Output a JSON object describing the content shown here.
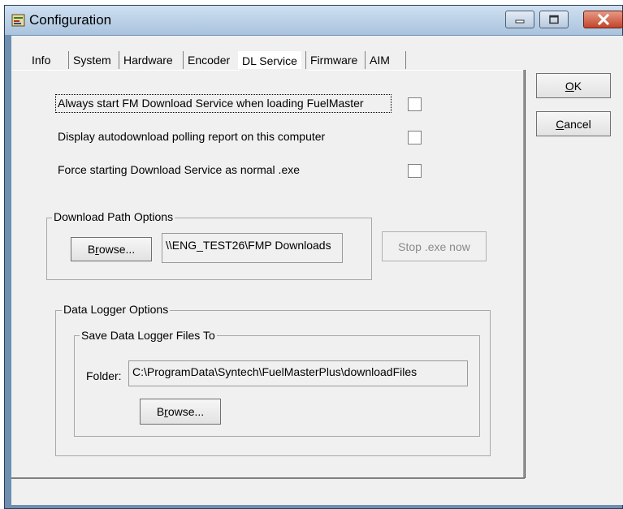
{
  "window": {
    "title": "Configuration",
    "icon": "configuration-app-icon",
    "controls": [
      "minimize-icon",
      "maximize-icon",
      "close-icon"
    ]
  },
  "tabs": [
    {
      "label": "Info",
      "active": false
    },
    {
      "label": "System",
      "active": false
    },
    {
      "label": "Hardware",
      "active": false
    },
    {
      "label": "Encoder",
      "active": false
    },
    {
      "label": "DL Service",
      "active": true
    },
    {
      "label": "Firmware",
      "active": false
    },
    {
      "label": "AIM",
      "active": false
    }
  ],
  "buttons": {
    "ok": {
      "pre": "",
      "mnemonic": "O",
      "post": "K"
    },
    "cancel": {
      "pre": "",
      "mnemonic": "C",
      "post": "ancel"
    }
  },
  "options": [
    {
      "label": "Always start FM Download Service  when loading FuelMaster",
      "checked": false
    },
    {
      "label": "Display autodownload polling report on this computer",
      "checked": false
    },
    {
      "label": "Force starting Download Service as normal .exe",
      "checked": false
    }
  ],
  "download_path": {
    "group_label": "Download Path Options",
    "browse": {
      "pre": "B",
      "mnemonic": "r",
      "post": "owse..."
    },
    "path_value": "\\\\ENG_TEST26\\FMP Downloads",
    "stop_button": "Stop .exe now"
  },
  "data_logger": {
    "group_label": "Data Logger Options",
    "save_group_label": "Save Data Logger Files To",
    "folder_label": "Folder:",
    "folder_value": "C:\\ProgramData\\Syntech\\FuelMasterPlus\\downloadFiles",
    "browse": {
      "pre": "B",
      "mnemonic": "r",
      "post": "owse..."
    }
  }
}
